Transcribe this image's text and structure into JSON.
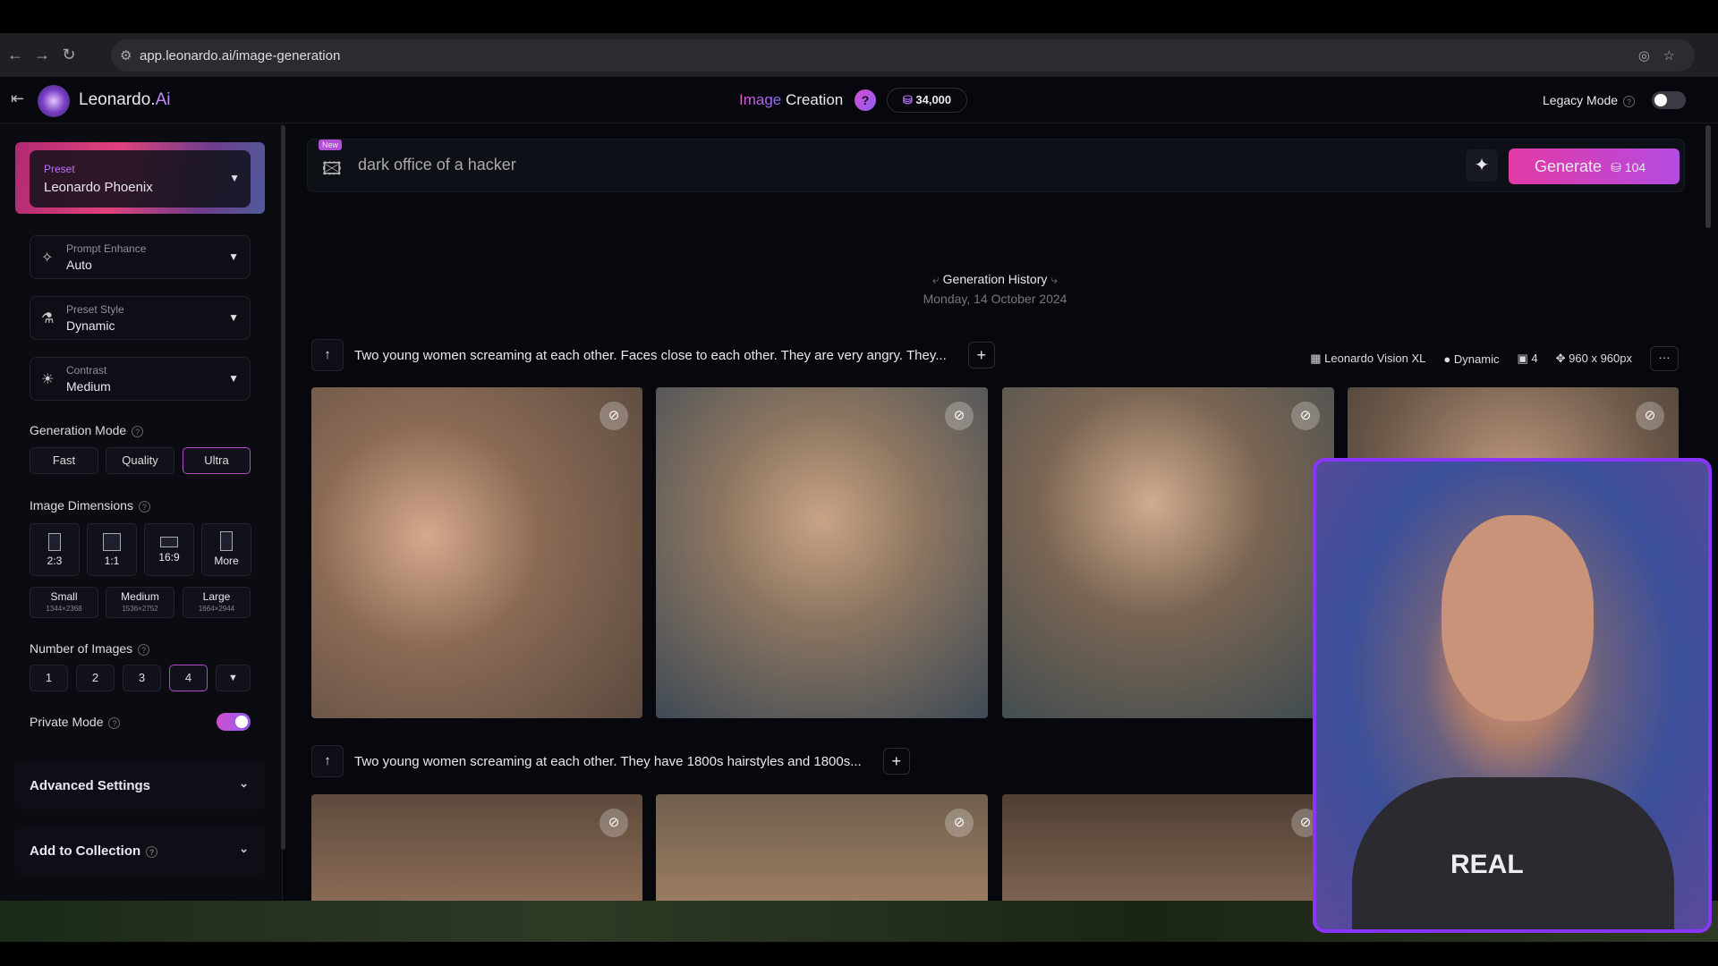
{
  "browser": {
    "url": "app.leonardo.ai/image-generation"
  },
  "header": {
    "brand_main": "Leonardo.",
    "brand_accent": "Ai",
    "title_accent": "Image",
    "title_main": "Creation",
    "help": "?",
    "tokens": "34,000",
    "legacy_label": "Legacy Mode",
    "legacy_on": false
  },
  "sidebar": {
    "preset": {
      "label": "Preset",
      "value": "Leonardo Phoenix"
    },
    "prompt_enhance": {
      "label": "Prompt Enhance",
      "value": "Auto"
    },
    "preset_style": {
      "label": "Preset Style",
      "value": "Dynamic"
    },
    "contrast": {
      "label": "Contrast",
      "value": "Medium"
    },
    "generation_mode": {
      "label": "Generation Mode",
      "options": [
        "Fast",
        "Quality",
        "Ultra"
      ],
      "selected": "Ultra"
    },
    "image_dimensions": {
      "label": "Image Dimensions",
      "ratios": [
        "2:3",
        "1:1",
        "16:9",
        "More"
      ],
      "selected_ratio": "More",
      "sizes": [
        {
          "name": "Small",
          "res": "1344×2368"
        },
        {
          "name": "Medium",
          "res": "1536×2752"
        },
        {
          "name": "Large",
          "res": "1664×2944"
        }
      ],
      "selected_size": "Large"
    },
    "number_of_images": {
      "label": "Number of Images",
      "options": [
        "1",
        "2",
        "3",
        "4"
      ],
      "selected": "4"
    },
    "private_mode": {
      "label": "Private Mode",
      "on": true
    },
    "advanced_settings": "Advanced Settings",
    "add_to_collection": "Add to Collection"
  },
  "prompt": {
    "badge": "New",
    "text": "dark office of a hacker",
    "generate_label": "Generate",
    "generate_cost": "104"
  },
  "history": {
    "title": "Generation History",
    "date": "Monday, 14 October 2024"
  },
  "generations": [
    {
      "prompt": "Two young women screaming at each other. Faces close to each other. They are very angry. They...",
      "model": "Leonardo Vision XL",
      "style": "Dynamic",
      "count": "4",
      "size": "960 x 960px"
    },
    {
      "prompt": "Two young women screaming at each other. They have 1800s hairstyles and 1800s..."
    }
  ],
  "webcam": {
    "shirt_text": "REAL"
  },
  "colors": {
    "accent": "#b44be0",
    "generate": "#e23aa6",
    "webcam_border": "#8a35ff"
  }
}
